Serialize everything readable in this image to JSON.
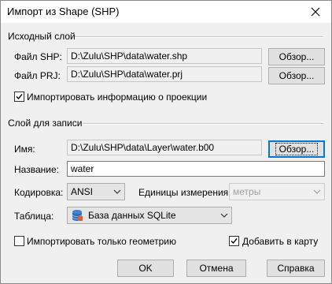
{
  "window": {
    "title": "Импорт из Shape (SHP)",
    "close_icon": "close-icon"
  },
  "source_group": {
    "title": "Исходный слой",
    "shp_label": "Файл SHP:",
    "shp_path": "D:\\Zulu\\SHP\\data\\water.shp",
    "shp_browse": "Обзор...",
    "prj_label": "Файл PRJ:",
    "prj_path": "D:\\Zulu\\SHP\\data\\water.prj",
    "prj_browse": "Обзор...",
    "import_projection_label": "Импортировать информацию о проекции",
    "import_projection_checked": true
  },
  "target_group": {
    "title": "Слой для записи",
    "name_label": "Имя:",
    "name_path": "D:\\Zulu\\SHP\\data\\Layer\\water.b00",
    "name_browse": "Обзор...",
    "caption_label": "Название:",
    "caption_value": "water",
    "encoding_label": "Кодировка:",
    "encoding_value": "ANSI",
    "units_label": "Единицы измерения:",
    "units_value": "метры",
    "units_disabled": true,
    "table_label": "Таблица:",
    "table_value": "База данных SQLite",
    "table_icon": "database-icon"
  },
  "options": {
    "geometry_only_label": "Импортировать только геометрию",
    "geometry_only_checked": false,
    "add_to_map_label": "Добавить в карту",
    "add_to_map_checked": true
  },
  "footer": {
    "ok_label": "OK",
    "cancel_label": "Отмена",
    "help_label": "Справка"
  }
}
